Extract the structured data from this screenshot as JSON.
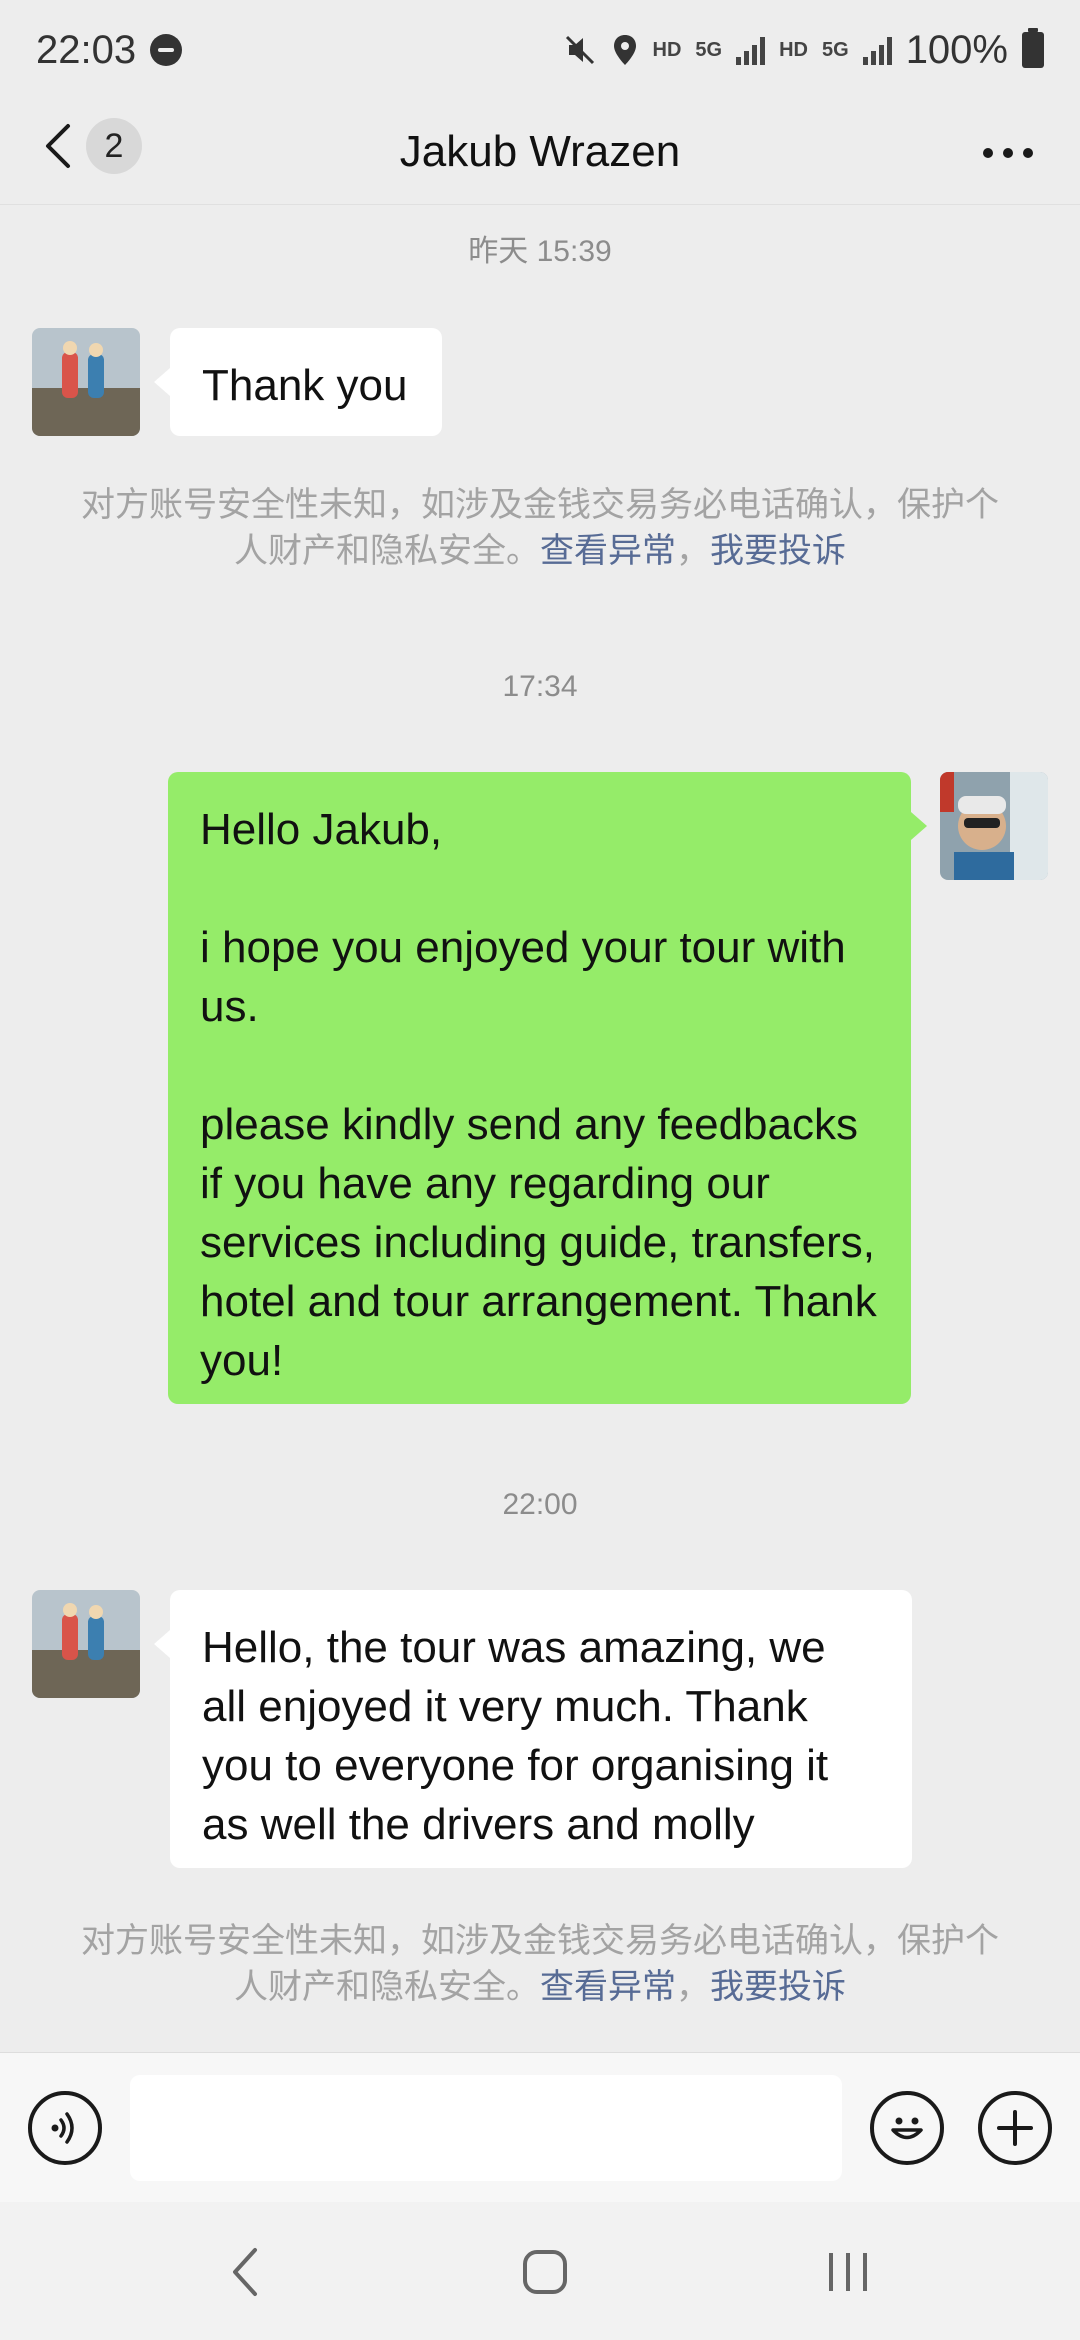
{
  "status_bar": {
    "time": "22:03",
    "hd1": "HD",
    "net1": "5G",
    "hd2": "HD",
    "net2": "5G",
    "battery": "100%"
  },
  "header": {
    "title": "Jakub Wrazen",
    "unread_count": "2"
  },
  "messages": {
    "time_1": "昨天 15:39",
    "msg_1": "Thank you",
    "time_2": "17:34",
    "msg_2": "Hello Jakub,\n\ni hope you enjoyed your tour with us.\n\nplease kindly send any feedbacks if you have any regarding our services including guide, transfers, hotel and tour arrangement. Thank you!",
    "time_3": "22:00",
    "msg_3": "Hello, the tour was amazing, we all enjoyed it very much. Thank you to everyone for organising it as well the drivers and molly"
  },
  "notice": {
    "text": "对方账号安全性未知，如涉及金钱交易务必电话确认，保护个人财产和隐私安全。",
    "link_view": "查看异常",
    "sep": "，",
    "link_report": "我要投诉"
  },
  "input": {
    "placeholder": ""
  },
  "icons": {
    "voice": "voice-icon",
    "emoji": "emoji-icon",
    "plus": "plus-icon",
    "back": "back-chevron-icon",
    "more": "more-dots-icon"
  }
}
